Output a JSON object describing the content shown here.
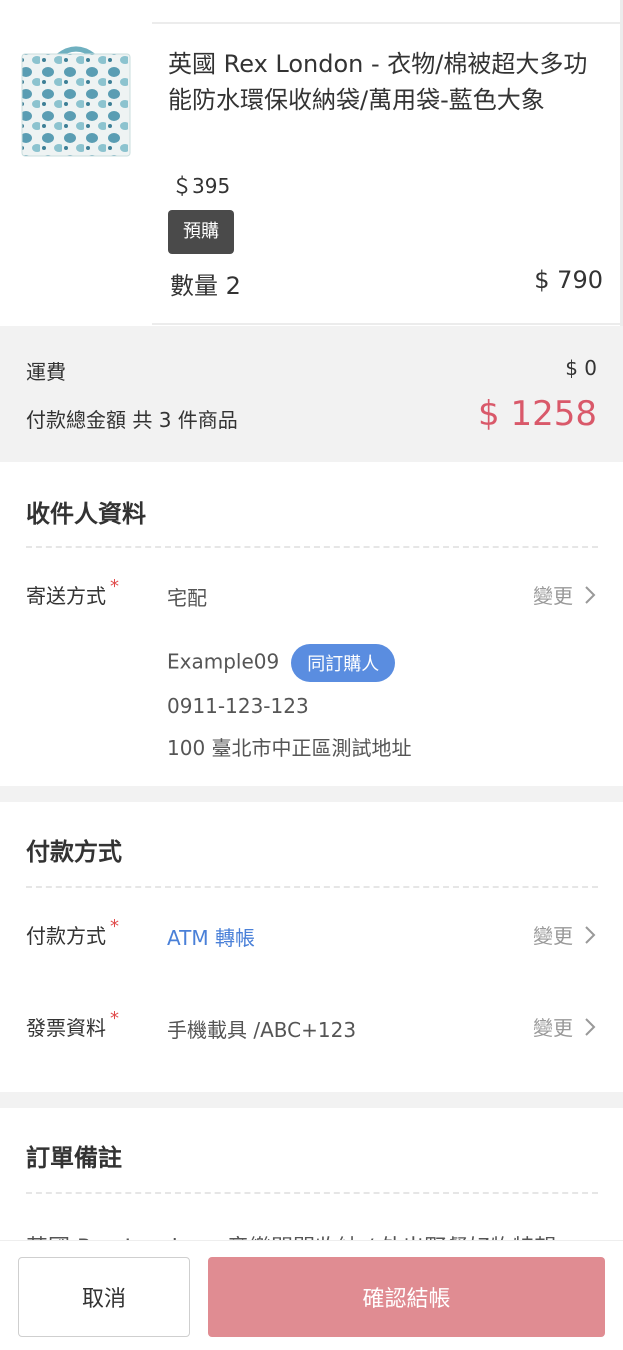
{
  "product": {
    "title": "英國 Rex London - 衣物/棉被超大多功能防水環保收納袋/萬用袋-藍色大象",
    "unit_price": "＄395",
    "badge": "預購",
    "quantity": "數量 2",
    "subtotal": "$ 790",
    "image_icon": "storage-bag-elephant-image"
  },
  "totals": {
    "shipping_label": "運費",
    "shipping_value": "$ 0",
    "total_label": "付款總金額 共 3 件商品",
    "total_value": "$ 1258"
  },
  "recipient": {
    "title": "收件人資料",
    "delivery_label": "寄送方式",
    "required_mark": "*",
    "delivery_value": "宅配",
    "change_label": "變更",
    "name": "Example09",
    "same_badge": "同訂購人",
    "phone": "0911-123-123",
    "address": "100 臺北市中正區測試地址"
  },
  "payment": {
    "title": "付款方式",
    "method_label": "付款方式",
    "method_value": "ATM 轉帳",
    "invoice_label": "發票資料",
    "invoice_value": "手機載具 /ABC+123",
    "change_label": "變更"
  },
  "notes": {
    "title": "訂單備註",
    "peek_text": "英國 Rex London - 音樂開關收納 / 外出野餐好物特輯"
  },
  "footer": {
    "cancel_label": "取消",
    "confirm_label": "確認結帳"
  },
  "colors": {
    "accent_red": "#d9596a",
    "link_blue": "#4a80d8",
    "badge_blue": "#5a8de0",
    "confirm_button": "#e08c92"
  }
}
